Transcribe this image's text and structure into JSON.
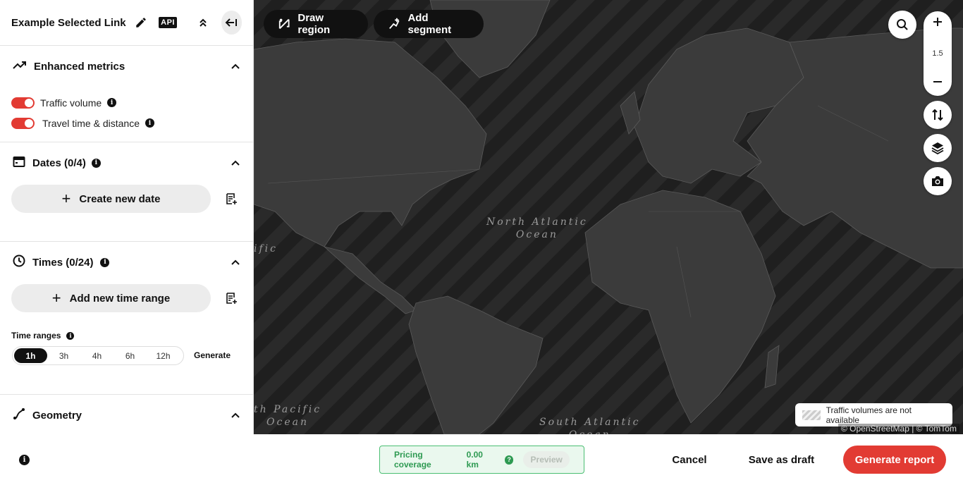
{
  "header": {
    "title": "Example Selected Link",
    "api_label": "API"
  },
  "enhanced_metrics": {
    "title": "Enhanced metrics",
    "toggles": [
      {
        "label": "Traffic volume",
        "on": true
      },
      {
        "label": "Travel time & distance",
        "on": true
      }
    ]
  },
  "dates": {
    "title": "Dates (0/4)",
    "create_label": "Create new date"
  },
  "times": {
    "title": "Times (0/24)",
    "add_label": "Add new time range",
    "ranges_label": "Time ranges",
    "ranges": [
      "1h",
      "3h",
      "4h",
      "6h",
      "12h"
    ],
    "selected_range": "1h",
    "generate_label": "Generate"
  },
  "geometry": {
    "title": "Geometry"
  },
  "map": {
    "draw_region_label": "Draw region",
    "add_segment_label": "Add segment",
    "zoom_level": "1.5",
    "ocean_labels": {
      "north_atlantic": "North Atlantic\nOcean",
      "pacific_fragment": "ific",
      "south_pacific_fragment": "th Pacific\nOcean",
      "south_atlantic": "South Atlantic\nOcean"
    },
    "legend_text": "Traffic volumes are not available",
    "attribution": "© OpenStreetMap | © TomTom"
  },
  "footer": {
    "pricing_label": "Pricing coverage",
    "pricing_value": "0.00 km",
    "preview_label": "Preview",
    "cancel_label": "Cancel",
    "save_draft_label": "Save as draft",
    "generate_report_label": "Generate report"
  },
  "colors": {
    "accent": "#e23b33",
    "pricing_green": "#2e9a52",
    "map_land": "#3b3b3b"
  },
  "icons": [
    "pencil-icon",
    "api-icon",
    "chevrons-up-icon",
    "collapse-left-icon",
    "trending-up-icon",
    "calendar-icon",
    "clock-icon",
    "geometry-icon",
    "chevron-up-icon",
    "info-icon",
    "plus-icon",
    "list-add-icon",
    "draw-region-icon",
    "add-segment-icon",
    "search-icon",
    "zoom-in-icon",
    "zoom-out-icon",
    "sort-arrows-icon",
    "layers-icon",
    "camera-icon"
  ]
}
